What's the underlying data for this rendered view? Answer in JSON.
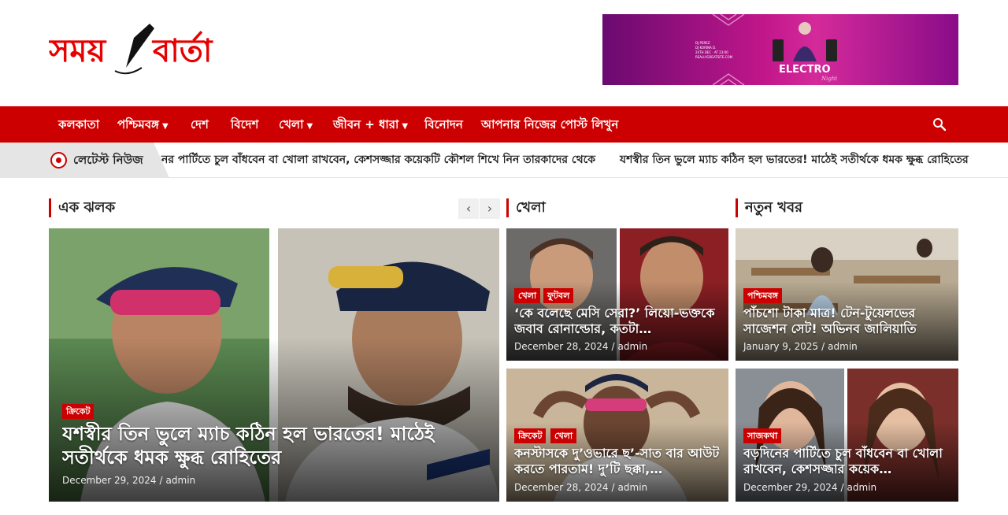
{
  "logo": {
    "text_left": "সময়",
    "text_right": "বার্তা"
  },
  "banner": {
    "lines": [
      "DJ PEREZ",
      "DJ KORINA D.",
      "24TH DEC · AT 23:00",
      "REALLYGREATSITE.COM"
    ],
    "brand": "ELECTRO",
    "brand_sub": "Night"
  },
  "nav": {
    "items": [
      {
        "label": "কলকাতা"
      },
      {
        "label": "পশ্চিমবঙ্গ",
        "dropdown": true
      },
      {
        "label": "দেশ"
      },
      {
        "label": "বিদেশ"
      },
      {
        "label": "খেলা",
        "dropdown": true
      },
      {
        "label": "জীবন + ধারা",
        "dropdown": true
      },
      {
        "label": "বিনোদন"
      },
      {
        "label": "আপনার নিজের পোস্ট লিখুন"
      }
    ],
    "search_icon": "search-icon"
  },
  "ticker": {
    "label": "লেটেস্ট নিউজ",
    "items": [
      "নর পার্টিতে চুল বাঁধবেন বা খোলা রাখবেন, কেশসজ্জার কয়েকটি কৌশল শিখে নিন তারকাদের থেকে",
      "যশস্বীর তিন ভুলে ম্যাচ কঠিন হল ভারতের! মাঠেই সতীর্থকে ধমক ক্ষুব্ধ রোহিতের"
    ]
  },
  "sections": {
    "ek_jholok": "এক ঝলক",
    "khela": "খেলা",
    "notun_khobor": "নতুন খবর"
  },
  "featured": {
    "category": "ক্রিকেট",
    "title": "যশস্বীর তিন ভুলে ম্যাচ কঠিন হল ভারতের! মাঠেই সতীর্থকে ধমক ক্ষুব্ধ রোহিতের",
    "date": "December 29, 2024",
    "author": "admin"
  },
  "khela_cards": [
    {
      "categories": [
        "খেলা",
        "ফুটবল"
      ],
      "title": "‘কে বলেছে মেসি সেরা?’ লিয়ো-ভক্তকে জবাব রোনাল্ডোর, কতটা…",
      "date": "December 28, 2024",
      "author": "admin"
    },
    {
      "categories": [
        "ক্রিকেট",
        "খেলা"
      ],
      "title": "কনস্টাসকে দু’ওভারে ছ’-সাত বার আউট করতে পারতাম! দু’টি ছক্কা,…",
      "date": "December 28, 2024",
      "author": "admin"
    }
  ],
  "notun_cards": [
    {
      "categories": [
        "পশ্চিমবঙ্গ"
      ],
      "title": "পাঁচশো টাকা মাত্র! টেন-টুয়েলভের সাজেশন সেট! অভিনব জালিয়াতি",
      "date": "January 9, 2025",
      "author": "admin"
    },
    {
      "categories": [
        "সাজকথা"
      ],
      "title": "বড়দিনের পার্টিতে চুল বাঁধবেন বা খোলা রাখবেন, কেশসজ্জার কয়েক…",
      "date": "December 29, 2024",
      "author": "admin"
    }
  ],
  "meta_separator": "/",
  "colors": {
    "brand_red": "#cc0000",
    "nav_bg": "#cc0000"
  }
}
